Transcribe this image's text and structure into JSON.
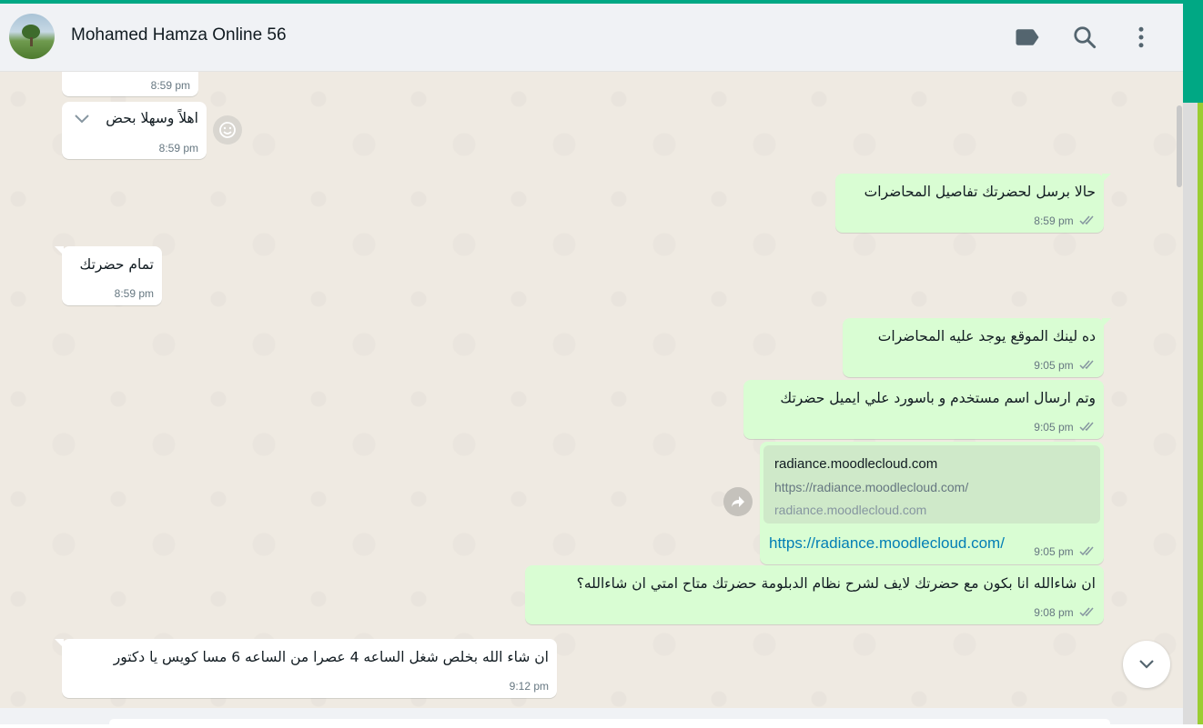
{
  "header": {
    "contact_name": "Mohamed Hamza Online 56",
    "icons": [
      "label-icon",
      "search-icon",
      "menu-icon"
    ]
  },
  "colors": {
    "accent": "#00a884",
    "incoming_bubble": "#ffffff",
    "outgoing_bubble": "#d9fdd3",
    "chat_background": "#efeae2",
    "link_color": "#027eb5"
  },
  "messages": [
    {
      "direction": "in",
      "text": "",
      "time": "8:59 pm"
    },
    {
      "direction": "in",
      "text": "اهلاً وسهلا بحض",
      "time": "8:59 pm"
    },
    {
      "direction": "out",
      "text": "حالا برسل لحضرتك تفاصيل المحاضرات",
      "time": "8:59 pm"
    },
    {
      "direction": "in",
      "text": "تمام حضرتك",
      "time": "8:59 pm"
    },
    {
      "direction": "out",
      "text": "ده لينك الموقع يوجد عليه المحاضرات",
      "time": "9:05 pm"
    },
    {
      "direction": "out",
      "text": "وتم ارسال اسم مستخدم و باسورد علي ايميل حضرتك",
      "time": "9:05 pm"
    },
    {
      "direction": "out",
      "link_title": "radiance.moodlecloud.com",
      "link_url_preview": "https://radiance.moodlecloud.com/",
      "link_domain": "radiance.moodlecloud.com",
      "text": "https://radiance.moodlecloud.com/",
      "time": "9:05 pm"
    },
    {
      "direction": "out",
      "text": "ان شاءالله انا بكون مع حضرتك لايف لشرح نظام الدبلومة حضرتك متاح امتي ان شاءالله؟",
      "time": "9:08 pm"
    },
    {
      "direction": "in",
      "text": "ان شاء الله بخلص شغل الساعه 4 عصرا  من الساعه 6 مسا كويس يا دكتور",
      "time": "9:12 pm"
    }
  ]
}
